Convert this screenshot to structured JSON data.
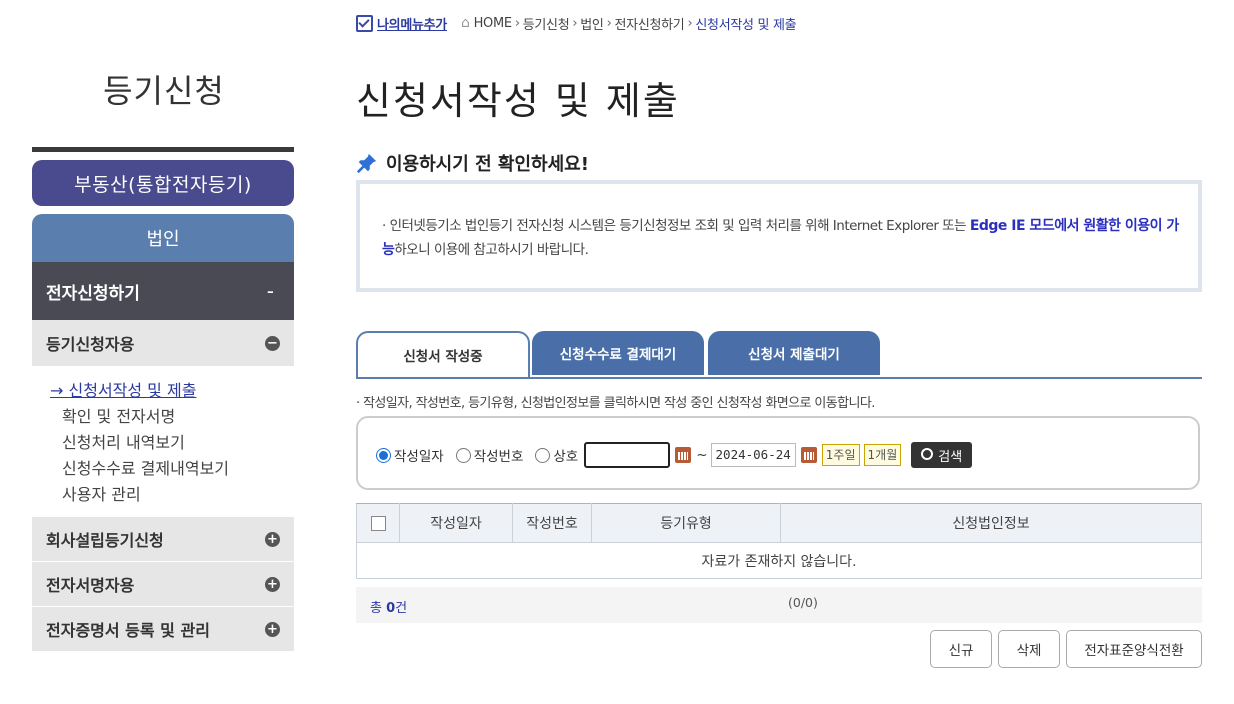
{
  "breadcrumb": {
    "my_menu": "나의메뉴추가",
    "items": [
      "HOME",
      "등기신청",
      "법인",
      "전자신청하기",
      "신청서작성 및 제출"
    ],
    "separator": "›"
  },
  "sidebar": {
    "title": "등기신청",
    "real_estate": "부동산(통합전자등기)",
    "corporation": "법인",
    "e_submit": {
      "label": "전자신청하기",
      "toggle": "-"
    },
    "groups": [
      {
        "label": "등기신청자용",
        "toggle": "−",
        "items": [
          {
            "label": "신청서작성 및 제출",
            "active": true
          },
          {
            "label": "확인 및 전자서명"
          },
          {
            "label": "신청처리 내역보기"
          },
          {
            "label": "신청수수료 결제내역보기"
          },
          {
            "label": "사용자 관리"
          }
        ]
      },
      {
        "label": "회사설립등기신청",
        "toggle": "+"
      },
      {
        "label": "전자서명자용",
        "toggle": "+"
      },
      {
        "label": "전자증명서 등록 및 관리",
        "toggle": "+"
      }
    ]
  },
  "main": {
    "title": "신청서작성 및 제출",
    "notice_heading": "이용하시기 전 확인하세요!",
    "notice": {
      "bullet": "·",
      "text_before": "인터넷등기소 법인등기 전자신청 시스템은 등기신청정보 조회 및 입력 처리를 위해 Internet Explorer 또는 ",
      "highlight": "Edge IE 모드에서 원활한 이용이 가능",
      "text_after": "하오니 이용에 참고하시기 바랍니다."
    },
    "tabs": [
      {
        "label": "신청서 작성중",
        "active": true
      },
      {
        "label": "신청수수료 결제대기"
      },
      {
        "label": "신청서 제출대기"
      }
    ],
    "hint": "· 작성일자, 작성번호, 등기유형, 신청법인정보를 클릭하시면 작성 중인 신청작성 화면으로 이동합니다.",
    "search": {
      "options": [
        {
          "label": "작성일자",
          "checked": true
        },
        {
          "label": "작성번호",
          "checked": false
        },
        {
          "label": "상호",
          "checked": false
        }
      ],
      "from_date": "",
      "tilde": "~",
      "to_date": "2024-06-24",
      "quick": [
        "1주일",
        "1개월"
      ],
      "search_button": "검색"
    },
    "table": {
      "headers": [
        "작성일자",
        "작성번호",
        "등기유형",
        "신청법인정보"
      ],
      "empty_message": "자료가 존재하지 않습니다."
    },
    "total": {
      "prefix": "총 ",
      "count": "0",
      "suffix": "건"
    },
    "paging": "(0/0)",
    "buttons": {
      "new": "신규",
      "delete": "삭제",
      "convert": "전자표준양식전환"
    }
  },
  "colors": {
    "accent_blue": "#2b3aa0",
    "tab_blue": "#4a6fa8",
    "nav_purple": "#4a4a8e",
    "nav_corp": "#5a7fae",
    "nav_dark": "#4a4a55",
    "highlight": "#2b2fbf"
  }
}
